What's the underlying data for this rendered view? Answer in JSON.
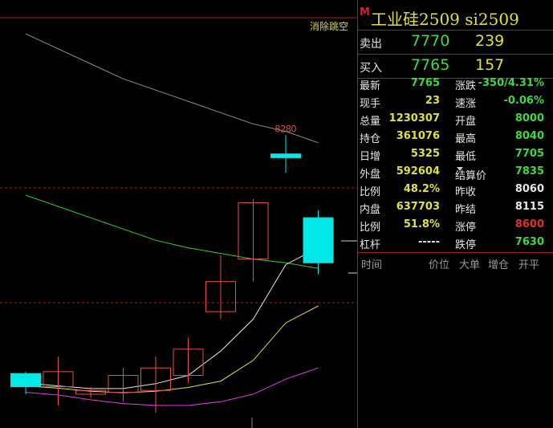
{
  "app": {
    "xiaochu_label": "消除跳空"
  },
  "header": {
    "badge": "M",
    "title": "工业硅2509  si2509"
  },
  "quote": {
    "ask": {
      "label": "卖出",
      "price": "7770",
      "volume": "239"
    },
    "bid": {
      "label": "买入",
      "price": "7765",
      "volume": "157"
    }
  },
  "stats": [
    {
      "l_label": "最新",
      "l_value": "7765",
      "l_color": "#40d840",
      "r_label": "涨跌",
      "r_value": "-350/4.31%",
      "r_color": "#40d840"
    },
    {
      "l_label": "现手",
      "l_value": "23",
      "l_color": "#e0e040",
      "r_label": "速涨",
      "r_value": "-0.06%",
      "r_color": "#40d840"
    },
    {
      "l_label": "总量",
      "l_value": "1230307",
      "l_color": "#e0e040",
      "r_label": "开盘",
      "r_value": "8000",
      "r_color": "#40d840"
    },
    {
      "l_label": "持仓",
      "l_value": "361076",
      "l_color": "#e0e040",
      "r_label": "最高",
      "r_value": "8040",
      "r_color": "#40d840"
    },
    {
      "l_label": "日增",
      "l_value": "5325",
      "l_color": "#e0e040",
      "r_label": "最低",
      "r_value": "7705",
      "r_color": "#40d840"
    },
    {
      "l_label": "外盘",
      "l_value": "592604",
      "l_color": "#e0e040",
      "r_label": "结算价",
      "r_value": "7835",
      "r_color": "#40d840"
    },
    {
      "l_label": "比例",
      "l_value": "48.2%",
      "l_color": "#e0e040",
      "r_label": "昨收",
      "r_value": "8060",
      "r_color": "#e6e6e6"
    },
    {
      "l_label": "内盘",
      "l_value": "637703",
      "l_color": "#e0e040",
      "r_label": "昨结",
      "r_value": "8115",
      "r_color": "#e6e6e6"
    },
    {
      "l_label": "比例",
      "l_value": "51.8%",
      "l_color": "#e0e040",
      "r_label": "涨停",
      "r_value": "8600",
      "r_color": "#e03030"
    },
    {
      "l_label": "杠杆",
      "l_value": "-----",
      "l_color": "#e6e6e6",
      "r_label": "跌停",
      "r_value": "7630",
      "r_color": "#40d840"
    }
  ],
  "ticks_header": {
    "time": "时间",
    "price": "价位",
    "big": "大单",
    "oi": "增仓",
    "kp": "开平"
  },
  "chart_data": {
    "type": "candlestick",
    "annotation_high": "8280",
    "colors": {
      "up": "#e05050",
      "down": "#00e8e8",
      "ma5": "#e8e8e8",
      "ma10": "#e0e040",
      "ma20": "#e040e0",
      "ma60": "#30d030",
      "ma120": "#909090",
      "dash": "#a02020"
    },
    "candles": [
      {
        "open": 7645,
        "close": 7610,
        "high": 7650,
        "low": 7590
      },
      {
        "open": 7610,
        "close": 7650,
        "high": 7690,
        "low": 7560
      },
      {
        "open": 7590,
        "close": 7600,
        "high": 7610,
        "low": 7580
      },
      {
        "open": 7595,
        "close": 7640,
        "high": 7660,
        "low": 7570
      },
      {
        "open": 7600,
        "close": 7660,
        "high": 7690,
        "low": 7540
      },
      {
        "open": 7640,
        "close": 7710,
        "high": 7740,
        "low": 7620
      },
      {
        "open": 7810,
        "close": 7890,
        "high": 7960,
        "low": 7790
      },
      {
        "open": 7950,
        "close": 8100,
        "high": 8110,
        "low": 7890
      },
      {
        "open": 8230,
        "close": 8220,
        "high": 8280,
        "low": 8180
      },
      {
        "open": 8060,
        "close": 7940,
        "high": 8080,
        "low": 7910
      }
    ],
    "ma5": [
      7620,
      7612,
      7605,
      7605,
      7618,
      7640,
      7705,
      7790,
      7935,
      7980
    ],
    "ma10": [
      7612,
      7606,
      7598,
      7594,
      7598,
      7608,
      7625,
      7680,
      7780,
      7825
    ],
    "ma20": [
      7595,
      7588,
      7575,
      7565,
      7560,
      7560,
      7570,
      7590,
      7630,
      7660
    ],
    "ma60": [
      8120,
      8090,
      8060,
      8030,
      8000,
      7980,
      7965,
      7950,
      7940,
      7925
    ],
    "ma120": [
      8550,
      8510,
      8470,
      8430,
      8400,
      8370,
      8340,
      8310,
      8290,
      8260
    ]
  }
}
